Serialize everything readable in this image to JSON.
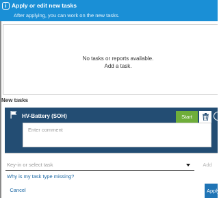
{
  "dialog": {
    "title": "Apply or edit new tasks",
    "subtitle": "After applying, you can work on the new tasks.",
    "info_icon": "i"
  },
  "reports": {
    "empty_line1": "No tasks or reports available.",
    "empty_line2": "Add a task."
  },
  "new_tasks": {
    "section_label": "New tasks",
    "task": {
      "title": "HV-Battery (SOH)",
      "start_label": "Start",
      "comment_placeholder": "Enter comment",
      "icons": [
        "flag-icon",
        "trash-icon",
        "more-icon"
      ]
    }
  },
  "task_picker": {
    "placeholder": "Key-in or select task",
    "add_label": "Add"
  },
  "missing_link": "Why is my task type missing?",
  "footer": {
    "cancel_label": "Cancel",
    "apply_label": "Apply"
  },
  "colors": {
    "header": "#1a8fd6",
    "task_card": "#234d73",
    "start": "#6fae3a",
    "link": "#1f6aa5",
    "apply": "#1f74b5"
  }
}
